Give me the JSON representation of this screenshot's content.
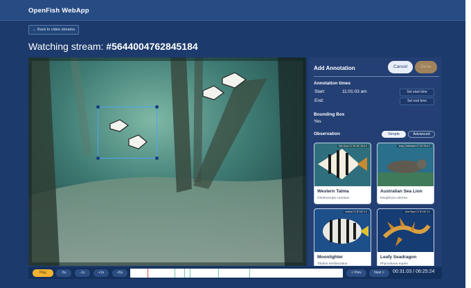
{
  "app": {
    "title": "OpenFish WebApp"
  },
  "nav": {
    "back_label": "← Back to video streams"
  },
  "page": {
    "title_prefix": "Watching stream: ",
    "stream_id": "#5644004762845184"
  },
  "annotation": {
    "heading": "Add Annotation",
    "cancel_label": "Cancel",
    "done_label": "Done",
    "times_heading": "Annotation times",
    "start_label": "Start:",
    "start_value": "11:01:03 am",
    "end_label": "End:",
    "set_start_label": "Set start time",
    "set_end_label": "Set end time",
    "bbox_heading": "Bounding Box",
    "bbox_value": "Yes",
    "observation_heading": "Observation",
    "mode_simple": "Simple",
    "mode_advanced": "Advanced"
  },
  "species": [
    {
      "name": "Western Talma",
      "scientific": "Chelmonops curiosus",
      "credit": "Nick Doan CC BY-NC-SA 4.0"
    },
    {
      "name": "Australian Sea Lion",
      "scientific": "Neophoca cinerea",
      "credit": "Jenny Sutherland CC BY-SA 4.0"
    },
    {
      "name": "Moonlighter",
      "scientific": "Tilodon sexfasciatus",
      "credit": "riverkat CC BY-NC 4.0"
    },
    {
      "name": "Leafy Seadragon",
      "scientific": "Phycodurus eques",
      "credit": "Jane Ryan CC BY-NC 4.0"
    }
  ],
  "controls": {
    "play_label": "Play",
    "skip_labels": [
      "-5s",
      "-1s",
      "+1s",
      "+5s"
    ],
    "prev_label": "< Prev",
    "next_label": "Next >",
    "time_current": "00:31:03",
    "time_total": "06:25:24",
    "time_separator": " / "
  },
  "colors": {
    "accent": "#f2b233",
    "panel": "#233f73",
    "bbox": "#4aa6f5"
  }
}
